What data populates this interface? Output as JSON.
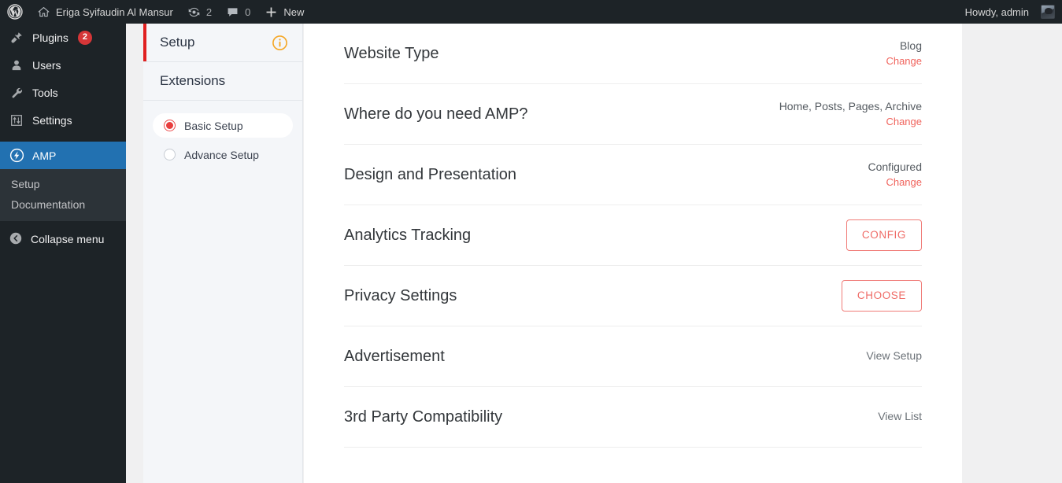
{
  "adminbar": {
    "wp_logo": "wordpress-logo-icon",
    "site_name": "Eriga Syifaudin Al Mansur",
    "home_icon": "home-icon",
    "updates_icon": "updates-icon",
    "updates_count": "2",
    "comments_icon": "comments-icon",
    "comments_count": "0",
    "new_icon": "plus-icon",
    "new_label": "New",
    "howdy": "Howdy, admin",
    "avatar": "user-avatar"
  },
  "adminmenu": {
    "items": [
      {
        "label": "Plugins",
        "icon": "plugins-icon",
        "badge": "2",
        "current": false
      },
      {
        "label": "Users",
        "icon": "users-icon",
        "badge": "",
        "current": false
      },
      {
        "label": "Tools",
        "icon": "tools-icon",
        "badge": "",
        "current": false
      },
      {
        "label": "Settings",
        "icon": "settings-icon",
        "badge": "",
        "current": false
      },
      {
        "label": "AMP",
        "icon": "amp-icon",
        "badge": "",
        "current": true
      }
    ],
    "submenu": [
      {
        "label": "Setup"
      },
      {
        "label": "Documentation"
      }
    ],
    "collapse": {
      "label": "Collapse menu",
      "icon": "collapse-icon"
    }
  },
  "nav_panel": {
    "tabs": [
      {
        "label": "Setup",
        "active": true,
        "info_icon": "info-icon"
      },
      {
        "label": "Extensions",
        "active": false,
        "info_icon": ""
      }
    ],
    "choices": [
      {
        "label": "Basic Setup",
        "selected": true
      },
      {
        "label": "Advance Setup",
        "selected": false
      }
    ]
  },
  "settings_rows": [
    {
      "title": "Website Type",
      "kind": "value-change",
      "value": "Blog",
      "change_label": "Change"
    },
    {
      "title": "Where do you need AMP?",
      "kind": "value-change",
      "value": "Home, Posts, Pages, Archive",
      "change_label": "Change"
    },
    {
      "title": "Design and Presentation",
      "kind": "value-change",
      "value": "Configured",
      "change_label": "Change"
    },
    {
      "title": "Analytics Tracking",
      "kind": "button",
      "button_label": "CONFIG"
    },
    {
      "title": "Privacy Settings",
      "kind": "button",
      "button_label": "CHOOSE"
    },
    {
      "title": "Advertisement",
      "kind": "link",
      "link_label": "View Setup"
    },
    {
      "title": "3rd Party Compatibility",
      "kind": "link",
      "link_label": "View List"
    }
  ],
  "colors": {
    "adminbar_bg": "#1d2327",
    "menu_bg": "#1d2327",
    "menu_current": "#2271b1",
    "badge_red": "#d63638",
    "accent_red": "#e02020",
    "radio_red": "#e83e3e",
    "button_red": "#ef6b66",
    "change_red": "#f0635c",
    "info_orange": "#f5a623",
    "panel_bg": "#f4f6f9",
    "page_bg": "#f0f0f1"
  }
}
